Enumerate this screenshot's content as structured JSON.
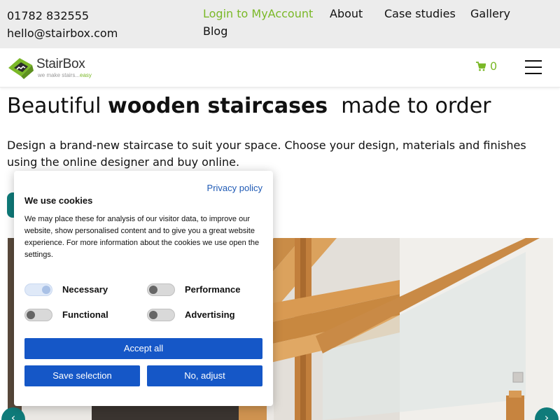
{
  "topbar": {
    "phone": "01782 832555",
    "email": "hello@stairbox.com",
    "nav": {
      "login": "Login to MyAccount",
      "about": "About",
      "case_studies": "Case studies",
      "gallery": "Gallery",
      "blog": "Blog"
    }
  },
  "header": {
    "logo_name": "StairBox",
    "logo_tagline": "we make stairs...",
    "logo_tagline_accent": "easy",
    "cart_count": "0",
    "icons": {
      "cart": "shopping-cart-icon",
      "menu": "hamburger-menu-icon"
    }
  },
  "hero": {
    "title_before": "Beautiful ",
    "title_bold": "wooden staircases",
    "title_after": "  made to order",
    "description": "Design a brand-new staircase to suit your space. Choose your design, materials and finishes using the online designer and buy online."
  },
  "cookie": {
    "privacy_link": "Privacy policy",
    "title": "We use cookies",
    "text": "We may place these for analysis of our visitor data, to improve our website, show personalised content and to give you a great website experience. For more information about the cookies we use open the settings.",
    "toggles": {
      "necessary": {
        "label": "Necessary",
        "on": true
      },
      "performance": {
        "label": "Performance",
        "on": false
      },
      "functional": {
        "label": "Functional",
        "on": false
      },
      "advertising": {
        "label": "Advertising",
        "on": false
      }
    },
    "accept_all": "Accept all",
    "save_selection": "Save selection",
    "no_adjust": "No, adjust"
  },
  "colors": {
    "brand_green": "#7ab827",
    "teal": "#0f7b7a",
    "button_blue": "#1557c7",
    "link_blue": "#1f5ab5"
  }
}
